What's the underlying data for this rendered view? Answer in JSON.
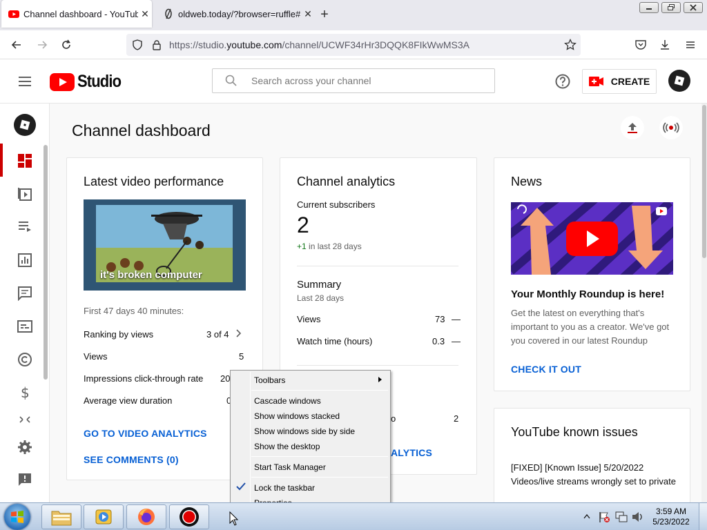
{
  "browser": {
    "tabs": [
      {
        "title": "Channel dashboard - YouTube",
        "active": true
      },
      {
        "title": "oldweb.today/?browser=ruffle#",
        "active": false
      }
    ],
    "url_prefix": "https://studio.",
    "url_domain": "youtube.com",
    "url_path": "/channel/UCWF34rHr3DQQK8FIkWwMS3A"
  },
  "studio": {
    "logo_text": "Studio",
    "search_placeholder": "Search across your channel",
    "create_label": "CREATE",
    "page_title": "Channel dashboard"
  },
  "latest_video": {
    "heading": "Latest video performance",
    "thumbnail_caption": "it's broken computer",
    "period": "First 47 days 40 minutes:",
    "rows": [
      {
        "label": "Ranking by views",
        "value": "3 of 4"
      },
      {
        "label": "Views",
        "value": "5"
      },
      {
        "label": "Impressions click-through rate",
        "value": "20"
      },
      {
        "label": "Average view duration",
        "value": "0"
      }
    ],
    "link_analytics": "GO TO VIDEO ANALYTICS",
    "link_comments": "SEE COMMENTS (0)"
  },
  "analytics": {
    "heading": "Channel analytics",
    "subs_label": "Current subscribers",
    "subs_value": "2",
    "subs_change": "+1",
    "subs_change_suffix": " in last 28 days",
    "summary_heading": "Summary",
    "summary_period": "Last 28 days",
    "rows": [
      {
        "label": "Views",
        "value": "73",
        "trend": "—"
      },
      {
        "label": "Watch time (hours)",
        "value": "0.3",
        "trend": "—"
      }
    ],
    "hidden_row_tail": "o",
    "hidden_row_value": "2",
    "link_tail": "ALYTICS"
  },
  "news": {
    "heading": "News",
    "item_title": "Your Monthly Roundup is here!",
    "item_body": "Get the latest on everything that's important to you as a creator. We've got you covered in our latest Roundup",
    "cta": "CHECK IT OUT"
  },
  "issues": {
    "heading": "YouTube known issues",
    "body": "[FIXED] [Known Issue] 5/20/2022 Videos/live streams wrongly set to private"
  },
  "context_menu": {
    "items": [
      {
        "label": "Toolbars",
        "submenu": true
      },
      {
        "label": "Cascade windows"
      },
      {
        "label": "Show windows stacked"
      },
      {
        "label": "Show windows side by side"
      },
      {
        "label": "Show the desktop"
      },
      {
        "label": "Start Task Manager"
      },
      {
        "label": "Lock the taskbar",
        "checked": true
      },
      {
        "label": "Properties"
      }
    ]
  },
  "taskbar": {
    "time": "3:59 AM",
    "date": "5/23/2022"
  },
  "colors": {
    "yt_red": "#ff0000",
    "link_blue": "#065fd4",
    "positive_green": "#107516",
    "accent_rail": "#cc0000"
  }
}
